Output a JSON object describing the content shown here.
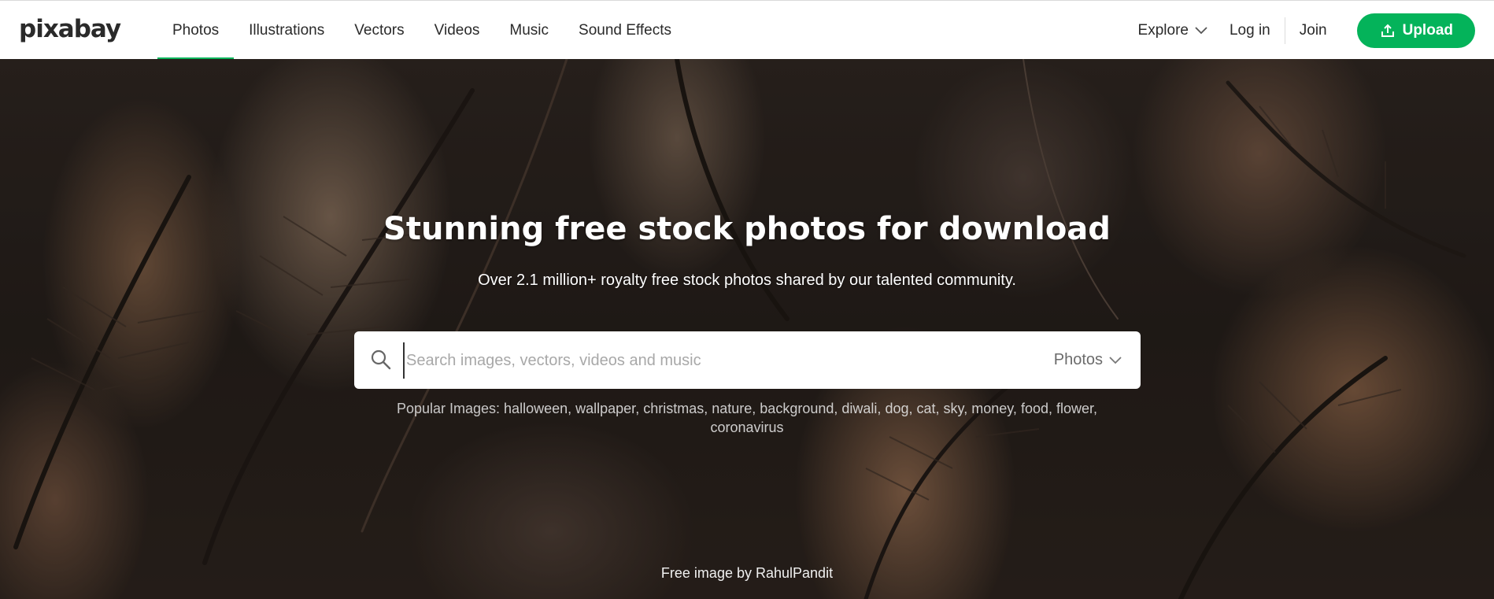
{
  "brand": {
    "logo_text": "pixabay"
  },
  "nav": {
    "items": [
      {
        "label": "Photos",
        "active": true
      },
      {
        "label": "Illustrations",
        "active": false
      },
      {
        "label": "Vectors",
        "active": false
      },
      {
        "label": "Videos",
        "active": false
      },
      {
        "label": "Music",
        "active": false
      },
      {
        "label": "Sound Effects",
        "active": false
      }
    ]
  },
  "header_right": {
    "explore_label": "Explore",
    "login_label": "Log in",
    "join_label": "Join",
    "upload_label": "Upload"
  },
  "hero": {
    "title": "Stunning free stock photos for download",
    "subtitle": "Over 2.1 million+ royalty free stock photos shared by our talented community."
  },
  "search": {
    "placeholder": "Search images, vectors, videos and music",
    "value": "",
    "type_selected": "Photos"
  },
  "popular": {
    "prefix": "Popular Images:",
    "tags": [
      "halloween",
      "wallpaper",
      "christmas",
      "nature",
      "background",
      "diwali",
      "dog",
      "cat",
      "sky",
      "money",
      "food",
      "flower",
      "coronavirus"
    ]
  },
  "credit": {
    "prefix": "Free image by",
    "author": "RahulPandit"
  },
  "colors": {
    "accent": "#04b35a",
    "text": "#2a2a2a",
    "hero_background": "#2a221d"
  },
  "icons": {
    "search": "search-icon",
    "chevron": "chevron-down-icon",
    "upload": "upload-icon"
  }
}
